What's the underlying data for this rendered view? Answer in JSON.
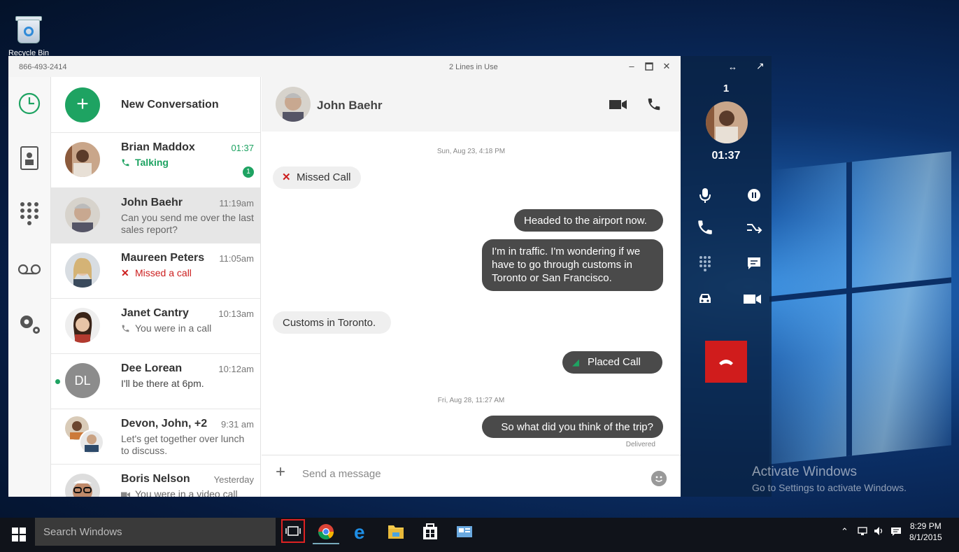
{
  "desktop": {
    "recycle_bin_label": "Recycle Bin",
    "activate_line1": "Activate Windows",
    "activate_line2": "Go to Settings to activate Windows."
  },
  "window": {
    "phone_number": "866-493-2414",
    "status": "2 Lines in Use",
    "minimize_icon": "minimize-icon",
    "maximize_icon": "maximize-icon",
    "close_icon": "close-icon"
  },
  "rail": {
    "items": [
      "recent-icon",
      "contacts-icon",
      "dialpad-icon",
      "voicemail-icon",
      "settings-icon"
    ]
  },
  "conversations": {
    "new_label": "New Conversation",
    "items": [
      {
        "name": "Brian Maddox",
        "time": "01:37",
        "preview": "Talking",
        "badge": "1"
      },
      {
        "name": "John Baehr",
        "time": "11:19am",
        "preview": "Can you send me over the last sales report?"
      },
      {
        "name": "Maureen Peters",
        "time": "11:05am",
        "preview": "Missed a call"
      },
      {
        "name": "Janet Cantry",
        "time": "10:13am",
        "preview": "You were in a call"
      },
      {
        "name": "Dee Lorean",
        "time": "10:12am",
        "preview": "I'll be there at 6pm.",
        "initials": "DL"
      },
      {
        "name": "Devon, John, +2",
        "time": "9:31 am",
        "preview": "Let's get together over lunch to discuss."
      },
      {
        "name": "Boris Nelson",
        "time": "Yesterday",
        "preview": "You were in a video call"
      }
    ]
  },
  "chat": {
    "contact_name": "John Baehr",
    "timestamp1": "Sun, Aug 23, 4:18 PM",
    "missed_call": "Missed Call",
    "msg1": "Headed to the airport now.",
    "msg2": "I'm in traffic. I'm wondering if we have to go through customs in Toronto or San Francisco.",
    "msg3": "Customs in Toronto.",
    "placed_call": "Placed Call",
    "timestamp2": "Fri, Aug 28, 11:27 AM",
    "msg4": "So what did you think of the trip?",
    "delivered": "Delivered",
    "composer_placeholder": "Send a message"
  },
  "call_panel": {
    "line_count": "1",
    "timer": "01:37"
  },
  "taskbar": {
    "search_placeholder": "Search Windows",
    "time": "8:29 PM",
    "date": "8/1/2015"
  },
  "colors": {
    "accent_green": "#1ea362",
    "missed_red": "#cc1f1f",
    "hangup_red": "#d01c1c"
  }
}
